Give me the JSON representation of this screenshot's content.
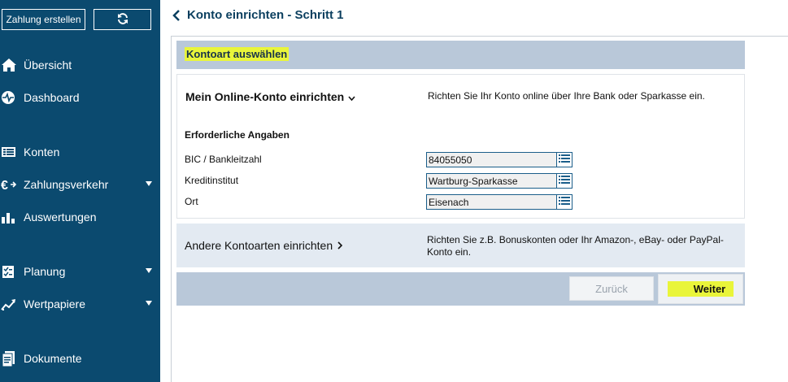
{
  "sidebar": {
    "create_payment_label": "Zahlung erstellen",
    "refresh_icon": "refresh-icon",
    "items": [
      {
        "label": "Übersicht",
        "icon": "home-icon"
      },
      {
        "label": "Dashboard",
        "icon": "pulse-icon"
      },
      {
        "label": "Konten",
        "icon": "list-icon"
      },
      {
        "label": "Zahlungsverkehr",
        "icon": "euro-transfer-icon",
        "has_submenu": true
      },
      {
        "label": "Auswertungen",
        "icon": "bar-chart-icon"
      },
      {
        "label": "Planung",
        "icon": "planning-icon",
        "has_submenu": true
      },
      {
        "label": "Wertpapiere",
        "icon": "trend-chart-icon",
        "has_submenu": true
      },
      {
        "label": "Dokumente",
        "icon": "documents-icon"
      }
    ]
  },
  "header": {
    "title": "Konto einrichten - Schritt 1"
  },
  "section": {
    "title": "Kontoart auswählen"
  },
  "online_account": {
    "title": "Mein Online-Konto einrichten",
    "description": "Richten Sie Ihr Konto online über Ihre Bank oder Sparkasse ein.",
    "required_title": "Erforderliche Angaben",
    "fields": [
      {
        "label": "BIC / Bankleitzahl",
        "value": "84055050"
      },
      {
        "label": "Kreditinstitut",
        "value": "Wartburg-Sparkasse"
      },
      {
        "label": "Ort",
        "value": "Eisenach"
      }
    ]
  },
  "other_accounts": {
    "title": "Andere Kontoarten einrichten",
    "description": "Richten Sie z.B. Bonuskonten oder Ihr Amazon-, eBay- oder PayPal-Konto ein."
  },
  "footer": {
    "back_label": "Zurück",
    "next_label": "Weiter"
  },
  "colors": {
    "sidebar_bg": "#0b4a6f",
    "section_bg": "#b9c8d9",
    "highlight": "#e9f53a",
    "field_border": "#1b5e8a"
  }
}
